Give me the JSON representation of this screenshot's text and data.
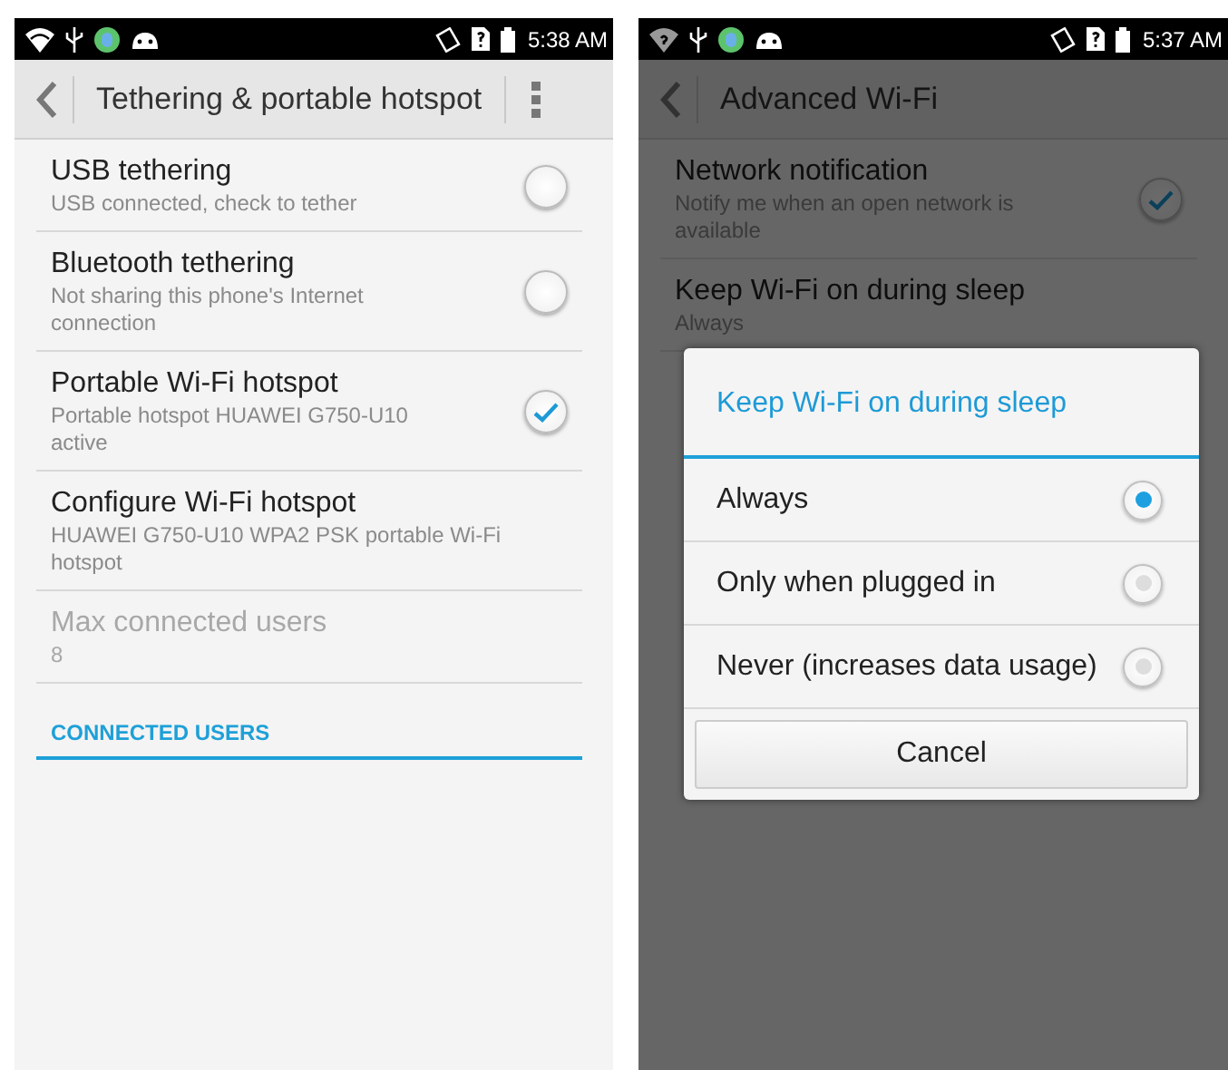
{
  "screens": [
    {
      "status_bar": {
        "time": "5:38 AM",
        "wifi_question": false
      },
      "title": "Tethering & portable hotspot",
      "overflow_menu": true,
      "dimmed": false,
      "items": [
        {
          "kind": "checkbox",
          "title": "USB tethering",
          "summary": "USB connected, check to tether",
          "checked": false,
          "disabled": false
        },
        {
          "kind": "checkbox",
          "title": "Bluetooth tethering",
          "summary": "Not sharing this phone's Internet connection",
          "checked": false,
          "disabled": false
        },
        {
          "kind": "checkbox",
          "title": "Portable Wi-Fi hotspot",
          "summary": "Portable hotspot HUAWEI G750-U10 active",
          "checked": true,
          "disabled": false
        },
        {
          "kind": "plain",
          "title": "Configure Wi-Fi hotspot",
          "summary": "HUAWEI G750-U10 WPA2 PSK portable Wi-Fi hotspot",
          "disabled": false
        },
        {
          "kind": "plain",
          "title": "Max connected users",
          "summary": "8",
          "disabled": true
        },
        {
          "kind": "header",
          "title": "CONNECTED USERS"
        }
      ]
    },
    {
      "status_bar": {
        "time": "5:37 AM",
        "wifi_question": true
      },
      "title": "Advanced Wi-Fi",
      "overflow_menu": false,
      "dimmed": true,
      "items": [
        {
          "kind": "checkbox",
          "title": "Network notification",
          "summary": "Notify me when an open network is available",
          "checked": true,
          "disabled": false
        },
        {
          "kind": "plain",
          "title": "Keep Wi-Fi on during sleep",
          "summary": "Always",
          "disabled": false
        }
      ],
      "dialog": {
        "title": "Keep Wi-Fi on during sleep",
        "options": [
          {
            "label": "Always",
            "selected": true
          },
          {
            "label": "Only when plugged in",
            "selected": false
          },
          {
            "label": "Never (increases data usage)",
            "selected": false
          }
        ],
        "button": "Cancel"
      }
    }
  ]
}
